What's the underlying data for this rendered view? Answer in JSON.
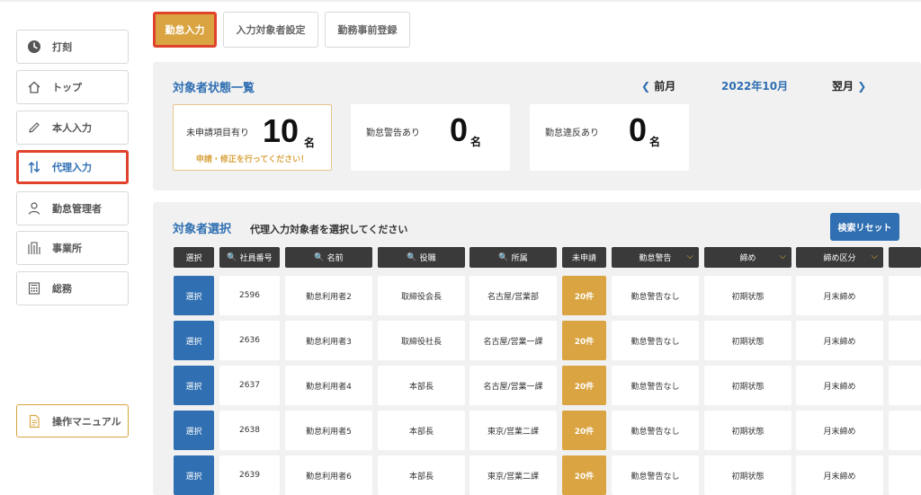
{
  "sidebar": {
    "items": [
      {
        "label": "打刻",
        "icon": "clock-icon"
      },
      {
        "label": "トップ",
        "icon": "home-icon"
      },
      {
        "label": "本人入力",
        "icon": "pencil-icon"
      },
      {
        "label": "代理入力",
        "icon": "swap-icon"
      },
      {
        "label": "勤怠管理者",
        "icon": "person-icon"
      },
      {
        "label": "事業所",
        "icon": "building-icon"
      },
      {
        "label": "総務",
        "icon": "calculator-icon"
      }
    ],
    "active_index": 3,
    "manual_label": "操作マニュアル"
  },
  "tabs": [
    {
      "label": "勤怠入力",
      "active": true
    },
    {
      "label": "入力対象者設定",
      "active": false
    },
    {
      "label": "勤務事前登録",
      "active": false
    }
  ],
  "status": {
    "title": "対象者状態一覧",
    "prev_month": "前月",
    "current_month": "2022年10月",
    "next_month": "翌月",
    "cards": [
      {
        "label": "未申請項目有り",
        "value": "10",
        "unit": "名",
        "hint": "申請・修正を行ってください！"
      },
      {
        "label": "勤怠警告あり",
        "value": "0",
        "unit": "名"
      },
      {
        "label": "勤怠違反あり",
        "value": "0",
        "unit": "名"
      }
    ]
  },
  "selection": {
    "title": "対象者選択",
    "caption": "代理入力対象者を選択してください",
    "reset_label": "検索リセット",
    "columns": [
      "選択",
      "社員番号",
      "名前",
      "役職",
      "所属",
      "未申請",
      "勤怠警告",
      "締め",
      "締め区分"
    ],
    "select_label": "選択",
    "rows": [
      {
        "id": "2596",
        "name": "勤怠利用者2",
        "position": "取締役会長",
        "dept": "名古屋/営業部",
        "pending": "20件",
        "warning": "勤怠警告なし",
        "closing": "初期状態",
        "closing_type": "月末締め"
      },
      {
        "id": "2636",
        "name": "勤怠利用者3",
        "position": "取締役社長",
        "dept": "名古屋/営業一課",
        "pending": "20件",
        "warning": "勤怠警告なし",
        "closing": "初期状態",
        "closing_type": "月末締め"
      },
      {
        "id": "2637",
        "name": "勤怠利用者4",
        "position": "本部長",
        "dept": "名古屋/営業一課",
        "pending": "20件",
        "warning": "勤怠警告なし",
        "closing": "初期状態",
        "closing_type": "月末締め"
      },
      {
        "id": "2638",
        "name": "勤怠利用者5",
        "position": "本部長",
        "dept": "東京/営業二課",
        "pending": "20件",
        "warning": "勤怠警告なし",
        "closing": "初期状態",
        "closing_type": "月末締め"
      },
      {
        "id": "2639",
        "name": "勤怠利用者6",
        "position": "本部長",
        "dept": "東京/営業二課",
        "pending": "20件",
        "warning": "勤怠警告なし",
        "closing": "初期状態",
        "closing_type": "月末締め"
      }
    ]
  },
  "colors": {
    "accent_blue": "#2f6fb2",
    "accent_gold": "#d9a441",
    "highlight_red": "#e0432b",
    "header_dark": "#3a3a3a"
  }
}
